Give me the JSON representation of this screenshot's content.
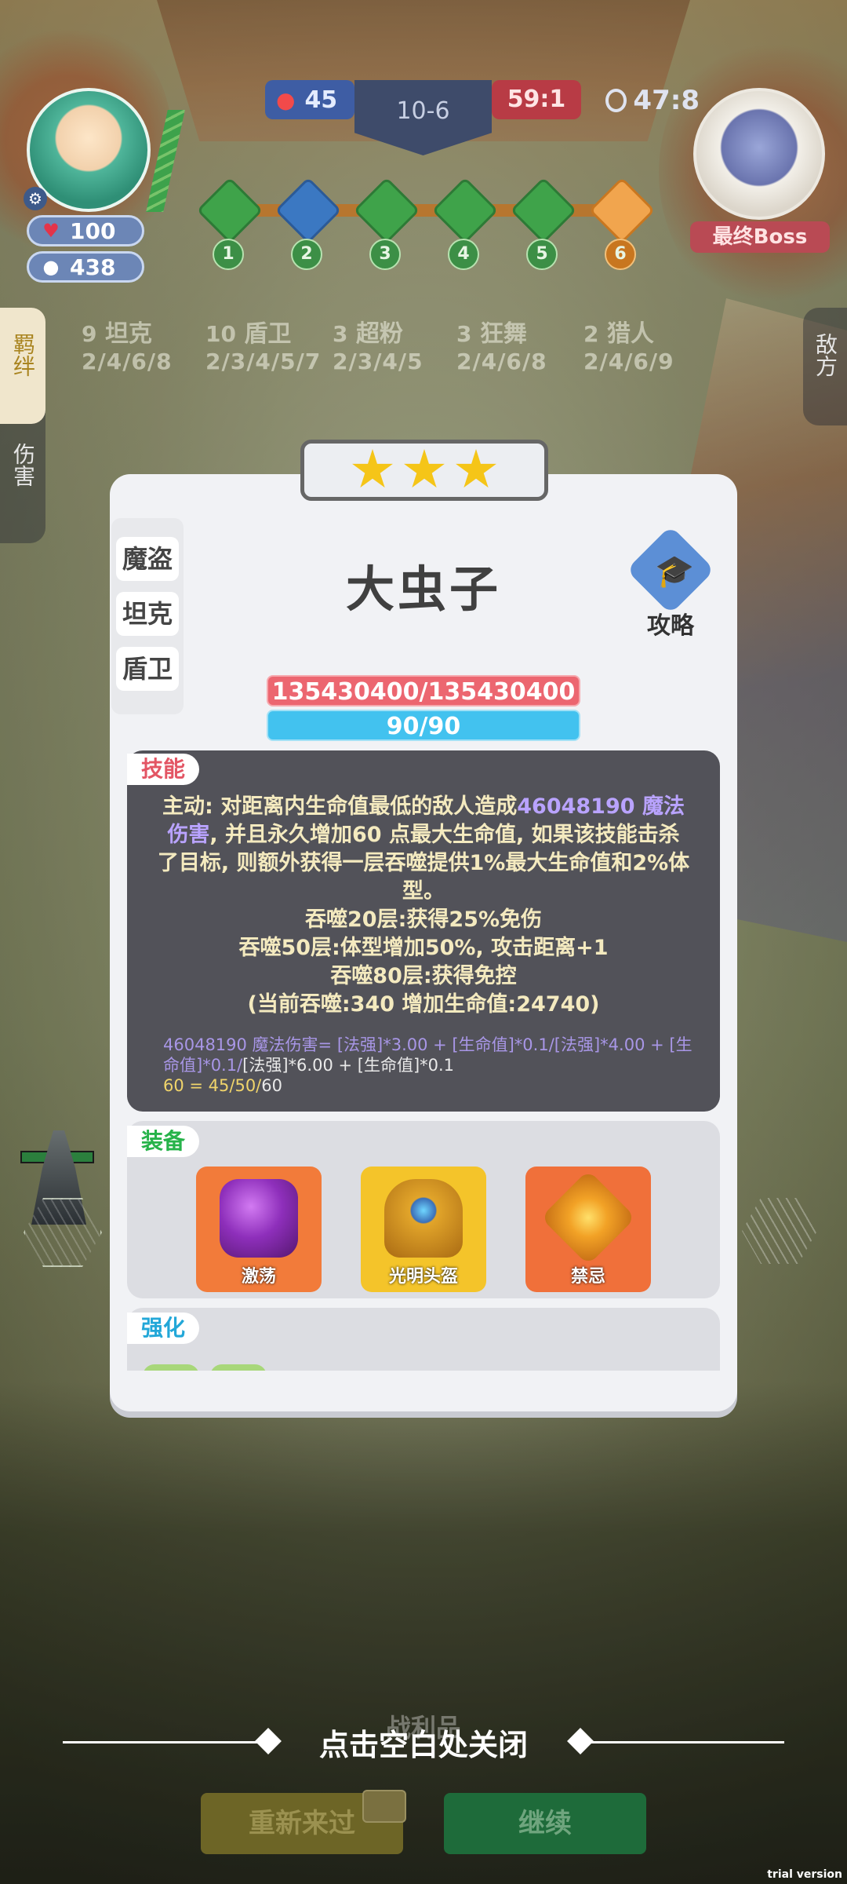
{
  "hud": {
    "hearts": "100",
    "coins": "438",
    "score_left": "45",
    "round": "10-6",
    "score_right": "59:1",
    "timer": "47:8",
    "boss_label": "最终Boss",
    "stages": [
      "1",
      "2",
      "3",
      "4",
      "5",
      "6"
    ]
  },
  "side": {
    "tab_bonds": "羁绊",
    "tab_damage": "伤害",
    "tab_enemy": "敌方"
  },
  "traits": [
    {
      "count": "9",
      "name": "坦克",
      "steps": "2/4/6/8"
    },
    {
      "count": "10",
      "name": "盾卫",
      "steps": "2/3/4/5/7"
    },
    {
      "count": "3",
      "name": "超粉",
      "steps": "2/3/4/5"
    },
    {
      "count": "3",
      "name": "狂舞",
      "steps": "2/4/6/8"
    },
    {
      "count": "2",
      "name": "猎人",
      "steps": "2/4/6/9"
    }
  ],
  "card": {
    "stars": 3,
    "tags": [
      "魔盗",
      "坦克",
      "盾卫"
    ],
    "name": "大虫子",
    "guide_label": "攻略",
    "hp": "135430400/135430400",
    "mp": "90/90",
    "skill_label": "技能",
    "skill": {
      "line1a": "主动: 对距离内生命值最低的敌人造成",
      "line1b": "46048190 魔法伤害",
      "line1c": ", 并且永久增加60 点最大生命值, 如果该技能击杀了目标, 则额外获得一层吞噬提供1%最大生命值和2%体型。",
      "line2": "吞噬20层:获得25%免伤",
      "line3": "吞噬50层:体型增加50%, 攻击距离+1",
      "line4": "吞噬80层:获得免控",
      "line5": "(当前吞噬:340 增加生命值:24740)"
    },
    "formula": {
      "a": "46048190 魔法伤害= [法强]*3.00 + [生命值]*0.1/[法强]*4.00 + [生命值]*0.1/",
      "b": "[法强]*6.00 + [生命值]*0.1",
      "c1": "60 = 45/50/",
      "c2": "60"
    },
    "equip_label": "装备",
    "items": [
      "激荡",
      "光明头盔",
      "禁忌"
    ],
    "enhance_label": "强化"
  },
  "bottom": {
    "close_hint": "点击空白处关闭",
    "loot_label": "战利品",
    "retry": "重新来过",
    "continue": "继续",
    "trial": "trial version"
  }
}
